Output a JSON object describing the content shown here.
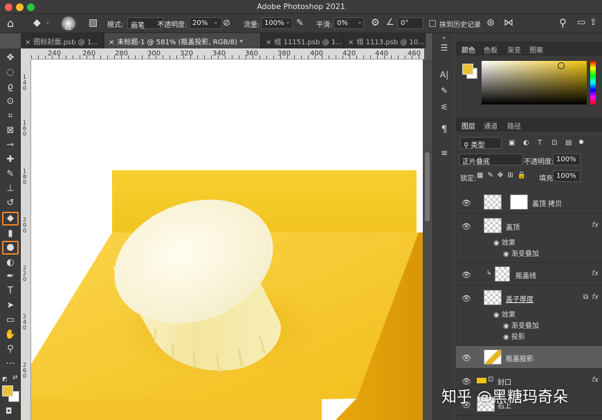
{
  "window": {
    "title": "Adobe Photoshop 2021"
  },
  "options": {
    "brush_size": "62",
    "mode_label": "模式:",
    "mode_value": "画笔",
    "opacity_label": "不透明度:",
    "opacity_value": "20%",
    "flow_label": "流量:",
    "flow_value": "100%",
    "smooth_label": "平滑:",
    "smooth_value": "0%",
    "angle_value": "0°",
    "erase_history_label": "抹到历史记录"
  },
  "doc_tabs": [
    {
      "label": "图标封面.psb @ 1..."
    },
    {
      "label": "未标题-1 @ 581% (瓶盖投影, RGB/8) *"
    },
    {
      "label": "组 11151.psb @ 1..."
    },
    {
      "label": "组 1113.psb @ 10..."
    }
  ],
  "ruler": {
    "top": [
      "240",
      "260",
      "280",
      "300",
      "320",
      "340",
      "360",
      "380",
      "400",
      "420",
      "440",
      "460"
    ],
    "left": [
      "140",
      "160",
      "180",
      "200",
      "220",
      "240",
      "260"
    ]
  },
  "color_panel": {
    "tabs": [
      "颜色",
      "色板",
      "渐变",
      "图案"
    ],
    "foreground": "#e8c33a",
    "background": "#ffffff",
    "hue": "#f1c40f"
  },
  "layers_panel": {
    "tabs": [
      "图层",
      "通道",
      "路径"
    ],
    "filter_label": "类型",
    "blend_mode": "正片叠底",
    "opacity_label": "不透明度:",
    "opacity_value": "100%",
    "lock_label": "锁定:",
    "fill_label": "填充:",
    "fill_value": "100%",
    "layers": [
      {
        "name": "盖顶 拷贝",
        "fx": ""
      },
      {
        "name": "盖顶",
        "fx": "fx"
      },
      {
        "name": "瓶盖线",
        "fx": "fx"
      },
      {
        "name": "盖子厚度",
        "fx": "fx"
      },
      {
        "name": "瓶盖投影",
        "fx": ""
      },
      {
        "name": "封口",
        "fx": "fx"
      },
      {
        "name": "右上",
        "fx": ""
      }
    ],
    "effects_label": "效果",
    "gradient_overlay": "渐变叠加",
    "drop_shadow": "投影"
  },
  "watermark": "知乎 @黑糖玛奇朵",
  "colors": {
    "accent_highlight": "#f2852a",
    "canvas_yellow": "#f3c52a"
  }
}
